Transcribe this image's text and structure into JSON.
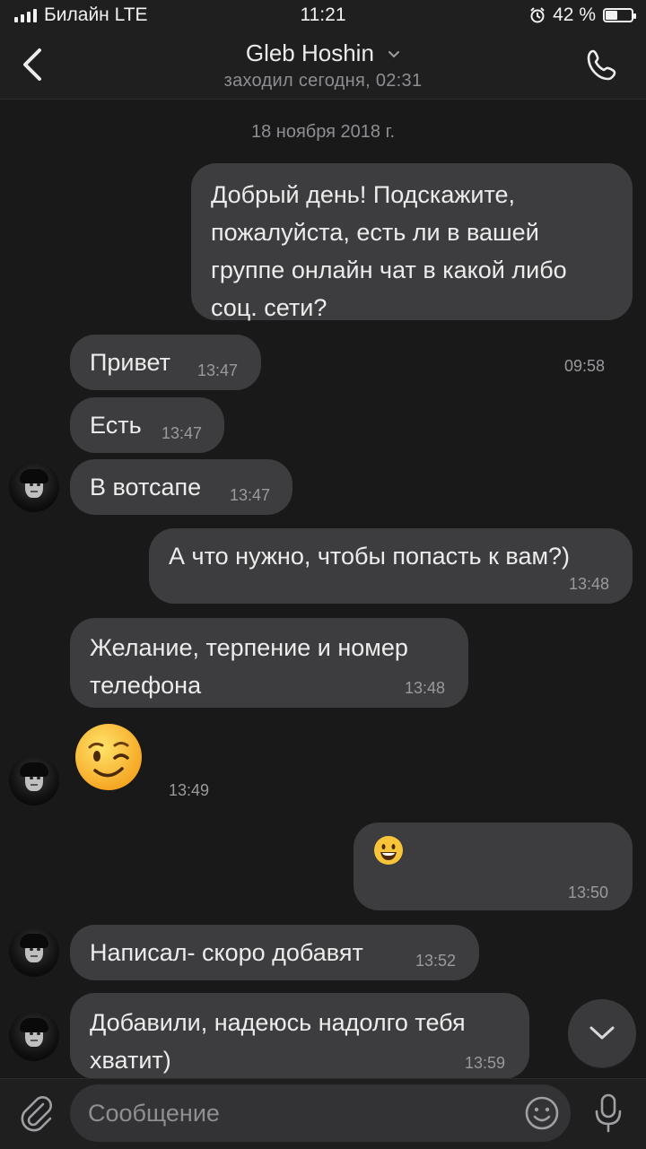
{
  "status_bar": {
    "carrier": "Билайн LTE",
    "time": "11:21",
    "battery": "42 %"
  },
  "header": {
    "name": "Gleb Hoshin",
    "status": "заходил сегодня, 02:31"
  },
  "chat": {
    "date": "18 ноября 2018 г.",
    "messages": [
      {
        "text": "Добрый день! Подскажите, пожалуйста, есть ли в вашей группе онлайн чат в какой либо соц. сети?",
        "time": "09:58"
      },
      {
        "text": "Привет",
        "time": "13:47"
      },
      {
        "text": "Есть",
        "time": "13:47"
      },
      {
        "text": "В вотсапе",
        "time": "13:47"
      },
      {
        "text": "А что нужно, чтобы попасть к вам?)",
        "time": "13:48"
      },
      {
        "text": "Желание, терпение и номер телефона",
        "time": "13:48"
      },
      {
        "emoji": "wink",
        "time": "13:49"
      },
      {
        "emoji": "smile",
        "time": "13:50"
      },
      {
        "text": "Написал- скоро добавят",
        "time": "13:52"
      },
      {
        "text": "Добавили, надеюсь надолго тебя хватит)",
        "time": "13:59"
      }
    ]
  },
  "composer": {
    "placeholder": "Сообщение"
  },
  "icons": {
    "back": "chevron-left-icon",
    "call": "phone-icon",
    "attach": "paperclip-icon",
    "emoji": "smile-icon",
    "mic": "microphone-icon",
    "scroll": "chevron-down-icon"
  }
}
